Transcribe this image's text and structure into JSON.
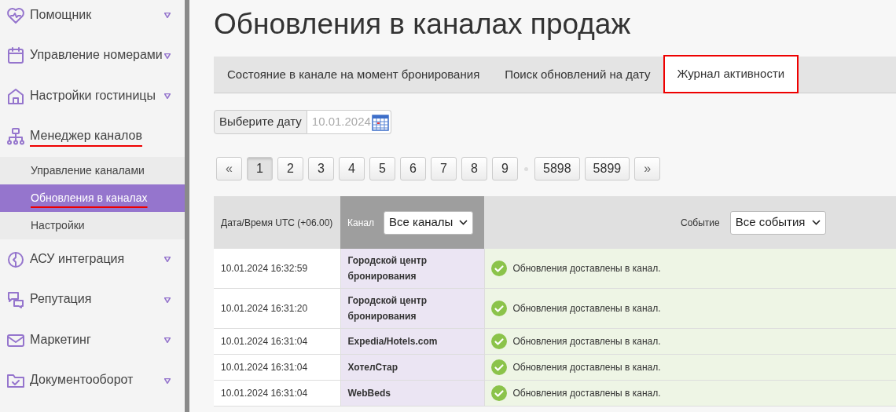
{
  "sidebar": {
    "items": [
      {
        "label": "Помощник",
        "underlined": false,
        "expandable": true
      },
      {
        "label": "Управление номерами",
        "underlined": false,
        "expandable": true
      },
      {
        "label": "Настройки гостиницы",
        "underlined": false,
        "expandable": true
      },
      {
        "label": "Менеджер каналов",
        "underlined": true,
        "expandable": false,
        "children": [
          {
            "label": "Управление каналами",
            "selected": false,
            "underlined": false
          },
          {
            "label": "Обновления в каналах",
            "selected": true,
            "underlined": true
          },
          {
            "label": "Настройки",
            "selected": false,
            "underlined": false
          }
        ]
      },
      {
        "label": "АСУ интеграция",
        "underlined": false,
        "expandable": true
      },
      {
        "label": "Репутация",
        "underlined": false,
        "expandable": true
      },
      {
        "label": "Маркетинг",
        "underlined": false,
        "expandable": true
      },
      {
        "label": "Документооборот",
        "underlined": false,
        "expandable": true
      }
    ]
  },
  "page_title": "Обновления в каналах продаж",
  "tabs": [
    {
      "label": "Состояние в канале на момент бронирования",
      "selected": false
    },
    {
      "label": "Поиск обновлений на дату",
      "selected": false
    },
    {
      "label": "Журнал активности",
      "selected": true
    }
  ],
  "date_picker": {
    "label": "Выберите дату",
    "value": "10.01.2024"
  },
  "pagination": [
    {
      "label": "«",
      "kind": "nav",
      "selected": false
    },
    {
      "label": "1",
      "kind": "page",
      "selected": true
    },
    {
      "label": "2",
      "kind": "page",
      "selected": false
    },
    {
      "label": "3",
      "kind": "page",
      "selected": false
    },
    {
      "label": "4",
      "kind": "page",
      "selected": false
    },
    {
      "label": "5",
      "kind": "page",
      "selected": false
    },
    {
      "label": "6",
      "kind": "page",
      "selected": false
    },
    {
      "label": "7",
      "kind": "page",
      "selected": false
    },
    {
      "label": "8",
      "kind": "page",
      "selected": false
    },
    {
      "label": "9",
      "kind": "page",
      "selected": false
    },
    {
      "kind": "gap"
    },
    {
      "label": "5898",
      "kind": "page",
      "selected": false
    },
    {
      "label": "5899",
      "kind": "page",
      "selected": false
    },
    {
      "label": "»",
      "kind": "nav",
      "selected": false
    }
  ],
  "table": {
    "columns": [
      {
        "label": "Дата/Время UTC (+06.00)"
      },
      {
        "label": "Канал",
        "filter": "Все каналы"
      },
      {
        "label": "Событие",
        "filter": "Все события"
      }
    ],
    "rows": [
      {
        "datetime": "10.01.2024 16:32:59",
        "channel": "Городской центр бронирования",
        "event": "Обновления доставлены в канал."
      },
      {
        "datetime": "10.01.2024 16:31:20",
        "channel": "Городской центр бронирования",
        "event": "Обновления доставлены в канал."
      },
      {
        "datetime": "10.01.2024 16:31:04",
        "channel": "Expedia/Hotels.com",
        "event": "Обновления доставлены в канал."
      },
      {
        "datetime": "10.01.2024 16:31:04",
        "channel": "ХотелСтар",
        "event": "Обновления доставлены в канал."
      },
      {
        "datetime": "10.01.2024 16:31:04",
        "channel": "WebBeds",
        "event": "Обновления доставлены в канал."
      }
    ]
  }
}
